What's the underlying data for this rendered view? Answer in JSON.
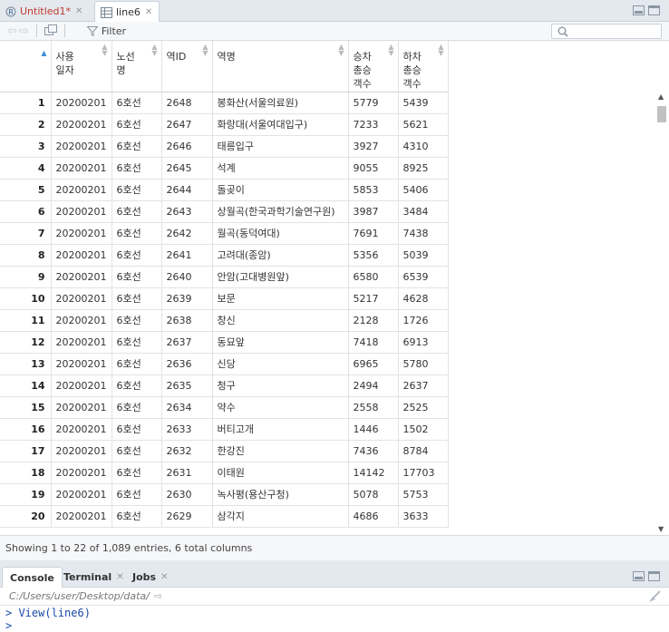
{
  "editor_tabs": [
    {
      "label": "Untitled1*",
      "icon": "r-script-icon",
      "active": false
    },
    {
      "label": "line6",
      "icon": "table-icon",
      "active": true
    }
  ],
  "toolbar": {
    "filter_label": "Filter",
    "search_placeholder": ""
  },
  "table": {
    "columns": [
      {
        "key": "index",
        "label": ""
      },
      {
        "key": "date",
        "label": "사용\n일자"
      },
      {
        "key": "line",
        "label": "노선\n명"
      },
      {
        "key": "station_id",
        "label": "역ID"
      },
      {
        "key": "station_name",
        "label": "역명"
      },
      {
        "key": "board",
        "label": "승차\n총승\n객수"
      },
      {
        "key": "alight",
        "label": "하차\n총승\n객수"
      }
    ],
    "rows": [
      [
        "1",
        "20200201",
        "6호선",
        "2648",
        "봉화산(서울의료원)",
        "5779",
        "5439"
      ],
      [
        "2",
        "20200201",
        "6호선",
        "2647",
        "화랑대(서울여대입구)",
        "7233",
        "5621"
      ],
      [
        "3",
        "20200201",
        "6호선",
        "2646",
        "태릉입구",
        "3927",
        "4310"
      ],
      [
        "4",
        "20200201",
        "6호선",
        "2645",
        "석계",
        "9055",
        "8925"
      ],
      [
        "5",
        "20200201",
        "6호선",
        "2644",
        "돌곶이",
        "5853",
        "5406"
      ],
      [
        "6",
        "20200201",
        "6호선",
        "2643",
        "상월곡(한국과학기술연구원)",
        "3987",
        "3484"
      ],
      [
        "7",
        "20200201",
        "6호선",
        "2642",
        "월곡(동덕여대)",
        "7691",
        "7438"
      ],
      [
        "8",
        "20200201",
        "6호선",
        "2641",
        "고려대(종암)",
        "5356",
        "5039"
      ],
      [
        "9",
        "20200201",
        "6호선",
        "2640",
        "안암(고대병원앞)",
        "6580",
        "6539"
      ],
      [
        "10",
        "20200201",
        "6호선",
        "2639",
        "보문",
        "5217",
        "4628"
      ],
      [
        "11",
        "20200201",
        "6호선",
        "2638",
        "창신",
        "2128",
        "1726"
      ],
      [
        "12",
        "20200201",
        "6호선",
        "2637",
        "동묘앞",
        "7418",
        "6913"
      ],
      [
        "13",
        "20200201",
        "6호선",
        "2636",
        "신당",
        "6965",
        "5780"
      ],
      [
        "14",
        "20200201",
        "6호선",
        "2635",
        "청구",
        "2494",
        "2637"
      ],
      [
        "15",
        "20200201",
        "6호선",
        "2634",
        "약수",
        "2558",
        "2525"
      ],
      [
        "16",
        "20200201",
        "6호선",
        "2633",
        "버티고개",
        "1446",
        "1502"
      ],
      [
        "17",
        "20200201",
        "6호선",
        "2632",
        "한강진",
        "7436",
        "8784"
      ],
      [
        "18",
        "20200201",
        "6호선",
        "2631",
        "이태원",
        "14142",
        "17703"
      ],
      [
        "19",
        "20200201",
        "6호선",
        "2630",
        "녹사평(용산구청)",
        "5078",
        "5753"
      ],
      [
        "20",
        "20200201",
        "6호선",
        "2629",
        "삼각지",
        "4686",
        "3633"
      ]
    ]
  },
  "status_text": "Showing 1 to 22 of 1,089 entries, 6 total columns",
  "console_tabs": [
    {
      "label": "Console",
      "closable": false
    },
    {
      "label": "Terminal",
      "closable": true
    },
    {
      "label": "Jobs",
      "closable": true
    }
  ],
  "console": {
    "path": "C:/Users/user/Desktop/data/",
    "lines": [
      "> View(line6)",
      ">"
    ]
  },
  "colors": {
    "accent": "#3d8fd6",
    "console_text": "#1a49a8",
    "unsaved_tab": "#c0392b"
  }
}
